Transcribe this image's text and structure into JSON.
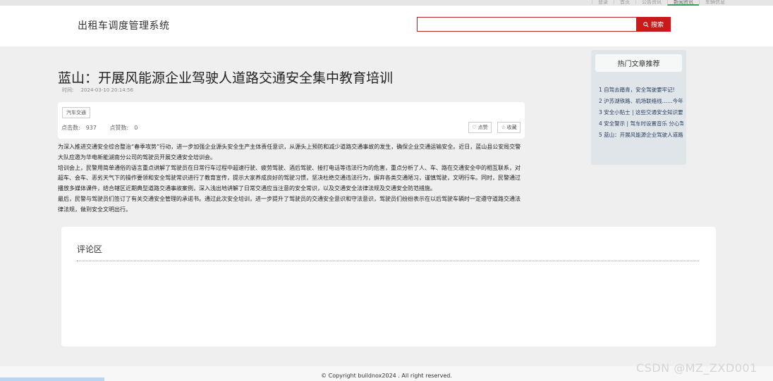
{
  "nav": {
    "items": [
      "登录",
      "首页",
      "公告资讯",
      "新闻资讯",
      "车辆信息"
    ]
  },
  "header": {
    "logo": "出租车调度管理系统",
    "search_placeholder": "",
    "search_button": "搜索"
  },
  "article": {
    "title": "蓝山：开展风能源企业驾驶人道路交通安全集中教育培训",
    "time_label": "时间:",
    "time_value": "2024-03-10 20:14:56",
    "tag": "汽车交通",
    "clicks_label": "点击数:",
    "clicks_value": "937",
    "likes_label": "点赞数:",
    "likes_value": "0",
    "like_button": "点赞",
    "fav_button": "收藏",
    "paragraphs": [
      "为深入推进交通安全综合整治“春季攻势”行动，进一步加强企业源头安全生产主体责任意识，从源头上预防和减少道路交通事故的发生，确保企业交通运输安全。近日，蓝山县公安局交警大队应邀为华电新能湖南分公司的驾驶员开展交通安全培训会。",
      "培训会上，民警用简单通俗的语言重点讲解了驾驶员在日常行车过程中超速行驶、疲劳驾驶、酒后驾驶、接打电话等违法行为的危害，重点分析了人、车、路在交通安全中的相互联系，对超车、会车、恶劣天气下的操作要领和安全驾驶常识进行了教育宣传，提示大家养成良好的驾驶习惯，坚决杜绝交通违法行为，摒弃各类交通陋习，谨慎驾驶，文明行车。同时，民警通过播放多媒体课件，结合辖区近期典型道路交通事故案例，深入浅出地讲解了日常交通应当注意的安全常识，以及交通安全法律法规及交通安全防范措施。",
      "最后，民警与驾驶员们签订了有关交通安全管理的承诺书。通过此次安全培训，进一步提升了驾驶员的交通安全意识和守法意识，驾驶员们纷纷表示在以后驾驶车辆时一定遵守道路交通法律法规，做到安全文明出行。"
    ]
  },
  "sidebar": {
    "title": "热门文章推荐",
    "items": [
      "1 自驾去踏青，安全驾驶要牢记!",
      "2 沪苏湖铁路、机场联络线……今年...",
      "3 安全小贴士 | 这些交通安全知识要...",
      "4 安全警示 | 驾车时设置音乐 分心驾...",
      "5 蓝山：开展风能源企业驾驶人道路..."
    ]
  },
  "comments": {
    "title": "评论区"
  },
  "footer": {
    "copyright": "© Copyright buildnox2024 . All right reserved."
  },
  "watermark": "CSDN @MZ_ZXD001"
}
